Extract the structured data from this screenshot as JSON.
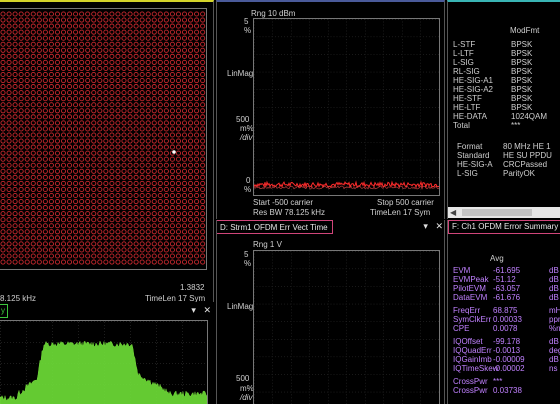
{
  "constellation": {
    "readout_value": "1.3832",
    "freq_frag": "8.125 kHz",
    "timelen": "TimeLen 17  Sym"
  },
  "spectrum_tab": {
    "tab_frag": "y"
  },
  "flatness": {
    "range": "Rng 10 dBm",
    "y_top_num": "5",
    "y_top_unit": "%",
    "linmag": "LinMag",
    "y_mid_num": "500",
    "y_mid_unit": "m%",
    "y_mid_div": "/div",
    "y_zero": "0",
    "y_zero_unit": "%",
    "start": "Start -500  carrier",
    "stop": "Stop 500  carrier",
    "resbw": "Res BW 78.125 kHz",
    "timelen": "TimeLen 17  Sym"
  },
  "errvect": {
    "title": "D: Strm1 OFDM Err Vect Time",
    "range": "Rng 1  V",
    "y_top_num": "5",
    "y_top_unit": "%",
    "linmag": "LinMag",
    "y_mid_num": "500",
    "y_mid_unit": "m%",
    "y_mid_div": "/div"
  },
  "modfmt": {
    "header": "ModFmt",
    "rows": [
      {
        "name": "L-STF",
        "val": "BPSK"
      },
      {
        "name": "L-LTF",
        "val": "BPSK"
      },
      {
        "name": "L-SIG",
        "val": "BPSK"
      },
      {
        "name": "RL-SIG",
        "val": "BPSK"
      },
      {
        "name": "HE-SIG-A1",
        "val": "BPSK"
      },
      {
        "name": "HE-SIG-A2",
        "val": "BPSK"
      },
      {
        "name": "HE-STF",
        "val": "BPSK"
      },
      {
        "name": "HE-LTF",
        "val": "BPSK"
      },
      {
        "name": "HE-DATA",
        "val": "1024QAM"
      },
      {
        "name": "Total",
        "val": "***"
      }
    ],
    "info": [
      {
        "name": "Format",
        "val": "80  MHz HE 1"
      },
      {
        "name": "Standard",
        "val": "HE SU PPDU"
      },
      {
        "name": "HE-SIG-A",
        "val": "CRCPassed"
      },
      {
        "name": "L-SIG",
        "val": "ParityOK"
      }
    ]
  },
  "errsum": {
    "title": "F: Ch1 OFDM Error Summary",
    "col_header": "Avg",
    "rows": [
      {
        "name": "EVM",
        "val": "-61.695",
        "unit": "dB"
      },
      {
        "name": "EVMPeak",
        "val": "-51.12",
        "unit": "dB"
      },
      {
        "name": "PilotEVM",
        "val": "-63.057",
        "unit": "dB"
      },
      {
        "name": "DataEVM",
        "val": "-61.676",
        "unit": "dB"
      },
      {
        "name": "FreqErr",
        "val": "68.875",
        "unit": "mHz"
      },
      {
        "name": "SymClkErr",
        "val": "0.00033",
        "unit": "ppm"
      },
      {
        "name": "CPE",
        "val": "0.0078",
        "unit": "%rms"
      },
      {
        "name": "IQOffset",
        "val": "-99.178",
        "unit": "dB"
      },
      {
        "name": "IQQuadErr",
        "val": "-0.0013",
        "unit": "deg"
      },
      {
        "name": "IQGainImb",
        "val": "-0.00009",
        "unit": "dB"
      },
      {
        "name": "IQTimeSkew",
        "val": "-0.00002",
        "unit": "ns"
      },
      {
        "name": "CrossPwr",
        "val": "***",
        "unit": ""
      },
      {
        "name": "CrossPwr",
        "val": "0.03738",
        "unit": ""
      }
    ]
  },
  "colors": {
    "yellow_border": "#d4d42a",
    "blue_border": "#4a5a9a",
    "pink_border": "#d0457a",
    "cyan_border": "#39b4b4",
    "green_border": "#3cc43c",
    "trace_red": "#ff2b2b",
    "trace_green": "#6fe038",
    "text_purple": "#c080ff"
  }
}
